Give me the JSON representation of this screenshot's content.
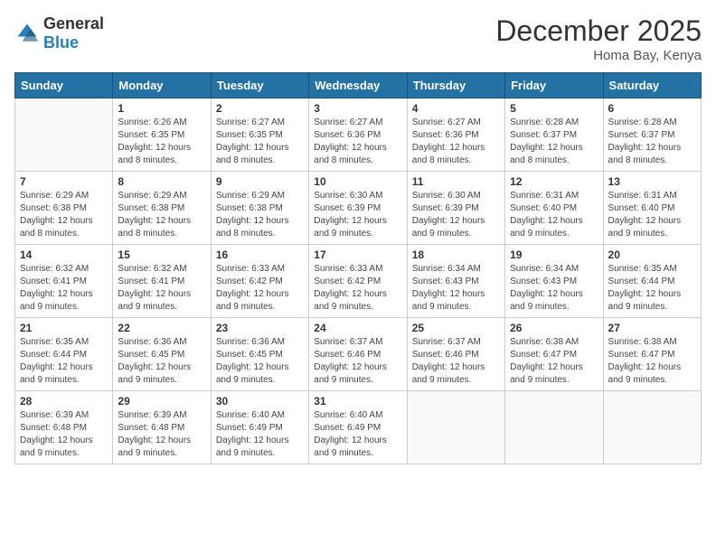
{
  "header": {
    "logo": {
      "general": "General",
      "blue": "Blue"
    },
    "title": "December 2025",
    "location": "Homa Bay, Kenya"
  },
  "days_of_week": [
    "Sunday",
    "Monday",
    "Tuesday",
    "Wednesday",
    "Thursday",
    "Friday",
    "Saturday"
  ],
  "weeks": [
    [
      {
        "day": "",
        "sunrise": "",
        "sunset": "",
        "daylight": ""
      },
      {
        "day": "1",
        "sunrise": "6:26 AM",
        "sunset": "6:35 PM",
        "daylight": "12 hours and 8 minutes."
      },
      {
        "day": "2",
        "sunrise": "6:27 AM",
        "sunset": "6:35 PM",
        "daylight": "12 hours and 8 minutes."
      },
      {
        "day": "3",
        "sunrise": "6:27 AM",
        "sunset": "6:36 PM",
        "daylight": "12 hours and 8 minutes."
      },
      {
        "day": "4",
        "sunrise": "6:27 AM",
        "sunset": "6:36 PM",
        "daylight": "12 hours and 8 minutes."
      },
      {
        "day": "5",
        "sunrise": "6:28 AM",
        "sunset": "6:37 PM",
        "daylight": "12 hours and 8 minutes."
      },
      {
        "day": "6",
        "sunrise": "6:28 AM",
        "sunset": "6:37 PM",
        "daylight": "12 hours and 8 minutes."
      }
    ],
    [
      {
        "day": "7",
        "sunrise": "6:29 AM",
        "sunset": "6:38 PM",
        "daylight": "12 hours and 8 minutes."
      },
      {
        "day": "8",
        "sunrise": "6:29 AM",
        "sunset": "6:38 PM",
        "daylight": "12 hours and 8 minutes."
      },
      {
        "day": "9",
        "sunrise": "6:29 AM",
        "sunset": "6:38 PM",
        "daylight": "12 hours and 8 minutes."
      },
      {
        "day": "10",
        "sunrise": "6:30 AM",
        "sunset": "6:39 PM",
        "daylight": "12 hours and 9 minutes."
      },
      {
        "day": "11",
        "sunrise": "6:30 AM",
        "sunset": "6:39 PM",
        "daylight": "12 hours and 9 minutes."
      },
      {
        "day": "12",
        "sunrise": "6:31 AM",
        "sunset": "6:40 PM",
        "daylight": "12 hours and 9 minutes."
      },
      {
        "day": "13",
        "sunrise": "6:31 AM",
        "sunset": "6:40 PM",
        "daylight": "12 hours and 9 minutes."
      }
    ],
    [
      {
        "day": "14",
        "sunrise": "6:32 AM",
        "sunset": "6:41 PM",
        "daylight": "12 hours and 9 minutes."
      },
      {
        "day": "15",
        "sunrise": "6:32 AM",
        "sunset": "6:41 PM",
        "daylight": "12 hours and 9 minutes."
      },
      {
        "day": "16",
        "sunrise": "6:33 AM",
        "sunset": "6:42 PM",
        "daylight": "12 hours and 9 minutes."
      },
      {
        "day": "17",
        "sunrise": "6:33 AM",
        "sunset": "6:42 PM",
        "daylight": "12 hours and 9 minutes."
      },
      {
        "day": "18",
        "sunrise": "6:34 AM",
        "sunset": "6:43 PM",
        "daylight": "12 hours and 9 minutes."
      },
      {
        "day": "19",
        "sunrise": "6:34 AM",
        "sunset": "6:43 PM",
        "daylight": "12 hours and 9 minutes."
      },
      {
        "day": "20",
        "sunrise": "6:35 AM",
        "sunset": "6:44 PM",
        "daylight": "12 hours and 9 minutes."
      }
    ],
    [
      {
        "day": "21",
        "sunrise": "6:35 AM",
        "sunset": "6:44 PM",
        "daylight": "12 hours and 9 minutes."
      },
      {
        "day": "22",
        "sunrise": "6:36 AM",
        "sunset": "6:45 PM",
        "daylight": "12 hours and 9 minutes."
      },
      {
        "day": "23",
        "sunrise": "6:36 AM",
        "sunset": "6:45 PM",
        "daylight": "12 hours and 9 minutes."
      },
      {
        "day": "24",
        "sunrise": "6:37 AM",
        "sunset": "6:46 PM",
        "daylight": "12 hours and 9 minutes."
      },
      {
        "day": "25",
        "sunrise": "6:37 AM",
        "sunset": "6:46 PM",
        "daylight": "12 hours and 9 minutes."
      },
      {
        "day": "26",
        "sunrise": "6:38 AM",
        "sunset": "6:47 PM",
        "daylight": "12 hours and 9 minutes."
      },
      {
        "day": "27",
        "sunrise": "6:38 AM",
        "sunset": "6:47 PM",
        "daylight": "12 hours and 9 minutes."
      }
    ],
    [
      {
        "day": "28",
        "sunrise": "6:39 AM",
        "sunset": "6:48 PM",
        "daylight": "12 hours and 9 minutes."
      },
      {
        "day": "29",
        "sunrise": "6:39 AM",
        "sunset": "6:48 PM",
        "daylight": "12 hours and 9 minutes."
      },
      {
        "day": "30",
        "sunrise": "6:40 AM",
        "sunset": "6:49 PM",
        "daylight": "12 hours and 9 minutes."
      },
      {
        "day": "31",
        "sunrise": "6:40 AM",
        "sunset": "6:49 PM",
        "daylight": "12 hours and 9 minutes."
      },
      {
        "day": "",
        "sunrise": "",
        "sunset": "",
        "daylight": ""
      },
      {
        "day": "",
        "sunrise": "",
        "sunset": "",
        "daylight": ""
      },
      {
        "day": "",
        "sunrise": "",
        "sunset": "",
        "daylight": ""
      }
    ]
  ]
}
